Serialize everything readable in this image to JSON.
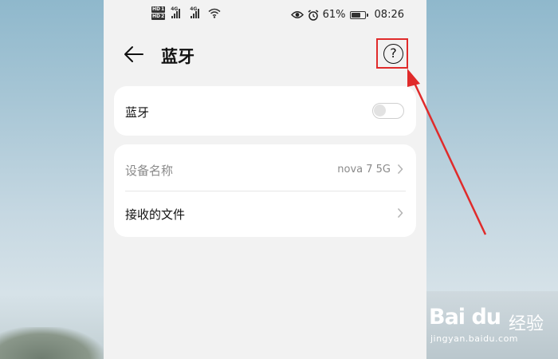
{
  "status_bar": {
    "hd_labels": [
      "HD",
      "HD"
    ],
    "sim_numbers": [
      "1",
      "2"
    ],
    "network_labels": [
      "4G",
      "4G"
    ],
    "battery_percent": "61%",
    "battery_level": 0.61,
    "time": "08:26",
    "icons": [
      "eye-icon",
      "alarm-icon",
      "wifi-icon",
      "battery-icon"
    ]
  },
  "header": {
    "back_icon": "arrow-left-icon",
    "title": "蓝牙",
    "help_icon": "question-circle-icon",
    "help_label": "?"
  },
  "bluetooth_card": {
    "label": "蓝牙",
    "toggle_on": false
  },
  "device_card": {
    "rows": [
      {
        "label": "设备名称",
        "value": "nova 7 5G",
        "dimmed": true
      },
      {
        "label": "接收的文件",
        "value": "",
        "dimmed": false
      }
    ]
  },
  "watermark": {
    "logo": "Bai du",
    "text": "经验",
    "url": "jingyan.baidu.com"
  },
  "colors": {
    "highlight": "#e02b2b",
    "screen_bg": "#f2f2f2",
    "card_bg": "#ffffff"
  }
}
